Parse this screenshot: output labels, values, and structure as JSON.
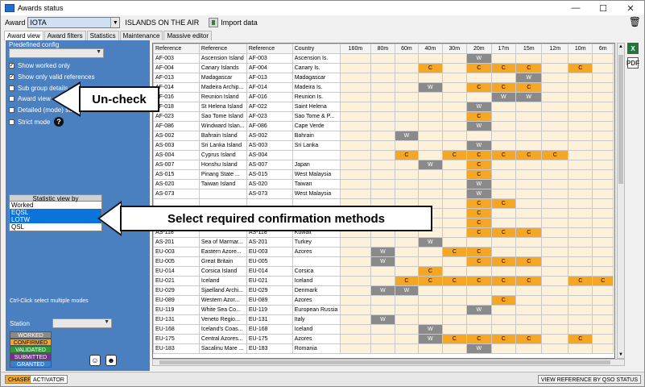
{
  "window": {
    "title": "Awards status",
    "controls": [
      "—",
      "☐",
      "✕"
    ]
  },
  "toolbar": {
    "award_label": "Award",
    "award_value": "IOTA",
    "award_name": "ISLANDS ON THE AIR",
    "import_label": "Import data",
    "trash_icon": "🗑"
  },
  "tabs": [
    "Award view",
    "Award filters",
    "Statistics",
    "Maintenance",
    "Massive editor"
  ],
  "left": {
    "predefined_label": "Predefined config",
    "checkboxes": [
      {
        "label": "Show worked only",
        "checked": "✓"
      },
      {
        "label": "Show only valid references",
        "checked": "✓"
      },
      {
        "label": "Sub group details",
        "checked": ""
      },
      {
        "label": "Award view",
        "checked": ""
      },
      {
        "label": "Detailed (mode) statistics",
        "checked": ""
      },
      {
        "label": "Strict mode",
        "checked": ""
      }
    ],
    "help": "?",
    "statistic_header": "Statistic view by",
    "stat_items": [
      "Worked",
      "EQSL",
      "LOTW",
      "QSL"
    ],
    "hint": "Ctrl-Click select multiple modes",
    "station_label": "Station",
    "legend": [
      "WORKED",
      "CONFIRMED",
      "VALIDATED",
      "SUBMITTED",
      "GRANTED"
    ],
    "round_buttons": [
      "☺",
      "☻"
    ]
  },
  "colors": {
    "panel": "#4a7fc0",
    "confirmed": "#f5a623",
    "worked": "#8a8a8a",
    "empty_band": "#fdf2d9",
    "validated": "#2e9b3b",
    "submitted": "#7a2a9a",
    "granted": "#3a7fd0"
  },
  "grid": {
    "headers": [
      "Reference",
      "Reference",
      "Reference",
      "Country",
      "160m",
      "80m",
      "60m",
      "40m",
      "30m",
      "20m",
      "17m",
      "15m",
      "12m",
      "10m",
      "6m"
    ],
    "rows": [
      [
        "AF-003",
        "Ascension Island",
        "AF-003",
        "Ascension Is.",
        "",
        "",
        "",
        "",
        "",
        "W",
        "",
        "",
        "",
        "",
        ""
      ],
      [
        "AF-004",
        "Canary Islands",
        "AF-004",
        "Canary Is.",
        "",
        "",
        "",
        "C",
        "",
        "C",
        "C",
        "C",
        "",
        "C",
        ""
      ],
      [
        "AF-013",
        "Madagascar",
        "AF-013",
        "Madagascar",
        "",
        "",
        "",
        "",
        "",
        "",
        "",
        "W",
        "",
        "",
        ""
      ],
      [
        "AF-014",
        "Madeira Archip...",
        "AF-014",
        "Madeira Is.",
        "",
        "",
        "",
        "W",
        "",
        "C",
        "C",
        "C",
        "",
        "",
        ""
      ],
      [
        "AF-016",
        "Reunion Island",
        "AF-016",
        "Reunion Is.",
        "",
        "",
        "",
        "",
        "",
        "",
        "W",
        "W",
        "",
        "",
        ""
      ],
      [
        "AF-018",
        "St Helena Island",
        "AF-022",
        "Saint Helena",
        "",
        "",
        "",
        "",
        "",
        "W",
        "",
        "",
        "",
        "",
        ""
      ],
      [
        "AF-023",
        "Sao Tome Island",
        "AF-023",
        "Sao Tome & P...",
        "",
        "",
        "",
        "",
        "",
        "C",
        "",
        "",
        "",
        "",
        ""
      ],
      [
        "AF-086",
        "Windward Islan...",
        "AF-086",
        "Cape Verde",
        "",
        "",
        "",
        "",
        "",
        "W",
        "",
        "",
        "",
        "",
        ""
      ],
      [
        "AS-002",
        "Bahrain Island",
        "AS-002",
        "Bahrain",
        "",
        "",
        "W",
        "",
        "",
        "",
        "",
        "",
        "",
        "",
        ""
      ],
      [
        "AS-003",
        "Sri Lanka Island",
        "AS-003",
        "Sri Lanka",
        "",
        "",
        "",
        "",
        "",
        "W",
        "",
        "",
        "",
        "",
        ""
      ],
      [
        "AS-004",
        "Cyprus Island",
        "AS-004",
        "",
        "",
        "",
        "C",
        "",
        "C",
        "C",
        "C",
        "C",
        "C",
        "",
        ""
      ],
      [
        "AS-007",
        "Honshu Island",
        "AS-007",
        "Japan",
        "",
        "",
        "",
        "W",
        "",
        "C",
        "",
        "",
        "",
        "",
        ""
      ],
      [
        "AS-015",
        "Pinang State ...",
        "AS-015",
        "West Malaysia",
        "",
        "",
        "",
        "",
        "",
        "C",
        "",
        "",
        "",
        "",
        ""
      ],
      [
        "AS-020",
        "Taiwan Island",
        "AS-020",
        "Taiwan",
        "",
        "",
        "",
        "",
        "",
        "W",
        "",
        "",
        "",
        "",
        ""
      ],
      [
        "AS-073",
        "",
        "AS-073",
        "West Malaysia",
        "",
        "",
        "",
        "",
        "",
        "W",
        "",
        "",
        "",
        "",
        ""
      ],
      [
        "",
        "",
        "",
        "",
        "",
        "",
        "",
        "",
        "",
        "C",
        "C",
        "",
        "",
        "",
        ""
      ],
      [
        "",
        "",
        "",
        "",
        "",
        "",
        "",
        "",
        "",
        "C",
        "",
        "",
        "",
        "",
        ""
      ],
      [
        "",
        "",
        "",
        "",
        "",
        "",
        "",
        "",
        "",
        "C",
        "",
        "",
        "",
        "",
        ""
      ],
      [
        "AS-118",
        "",
        "AS-118",
        "Kuwait",
        "",
        "",
        "",
        "",
        "",
        "C",
        "C",
        "C",
        "",
        "",
        ""
      ],
      [
        "AS-201",
        "Sea of Marmar...",
        "AS-201",
        "Turkey",
        "",
        "",
        "",
        "W",
        "",
        "",
        "",
        "",
        "",
        "",
        ""
      ],
      [
        "EU-003",
        "Eastern Azore...",
        "EU-003",
        "Azores",
        "",
        "W",
        "",
        "",
        "C",
        "C",
        "",
        "",
        "",
        "",
        ""
      ],
      [
        "EU-005",
        "Great Britain",
        "EU-005",
        "",
        "",
        "W",
        "",
        "",
        "",
        "C",
        "C",
        "C",
        "",
        "",
        ""
      ],
      [
        "EU-014",
        "Corsica Island",
        "EU-014",
        "Corsica",
        "",
        "",
        "",
        "C",
        "",
        "",
        "",
        "",
        "",
        "",
        ""
      ],
      [
        "EU-021",
        "Iceland",
        "EU-021",
        "Iceland",
        "",
        "",
        "C",
        "C",
        "C",
        "C",
        "C",
        "C",
        "",
        "C",
        "C"
      ],
      [
        "EU-029",
        "Sjaelland Archi...",
        "EU-029",
        "Denmark",
        "",
        "W",
        "W",
        "",
        "",
        "",
        "",
        "",
        "",
        "",
        ""
      ],
      [
        "EU-089",
        "Western Azor...",
        "EU-089",
        "Azores",
        "",
        "",
        "",
        "",
        "",
        "",
        "C",
        "",
        "",
        "",
        ""
      ],
      [
        "EU-119",
        "White Sea Co...",
        "EU-119",
        "European Russia",
        "",
        "",
        "",
        "",
        "",
        "W",
        "",
        "",
        "",
        "",
        ""
      ],
      [
        "EU-131",
        "Veneto Regio...",
        "EU-131",
        "Italy",
        "",
        "W",
        "",
        "",
        "",
        "",
        "",
        "",
        "",
        "",
        ""
      ],
      [
        "EU-168",
        "Iceland's Coas...",
        "EU-168",
        "Iceland",
        "",
        "",
        "",
        "W",
        "",
        "",
        "",
        "",
        "",
        "",
        ""
      ],
      [
        "EU-175",
        "Central Azores...",
        "EU-175",
        "Azores",
        "",
        "",
        "",
        "W",
        "C",
        "C",
        "C",
        "C",
        "",
        "C",
        ""
      ],
      [
        "EU-183",
        "Sacalinu Mare ...",
        "EU-183",
        "Romania",
        "",
        "",
        "",
        "",
        "",
        "W",
        "",
        "",
        "",
        "",
        ""
      ]
    ]
  },
  "side_icons": [
    "X",
    "PDF"
  ],
  "status": {
    "chaser": "CHASER",
    "activator": "ACTIVATOR",
    "view_ref": "VIEW REFERENCE BY QSO STATUS"
  },
  "callouts": {
    "uncheck": "Un-check",
    "select": "Select required confirmation methods"
  }
}
